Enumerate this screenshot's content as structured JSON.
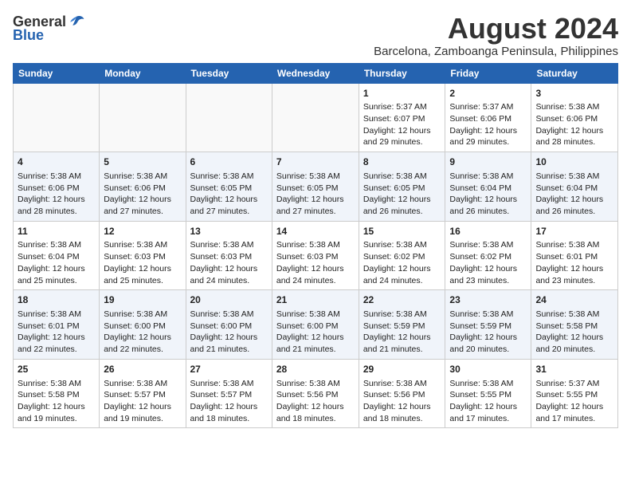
{
  "logo": {
    "general": "General",
    "blue": "Blue"
  },
  "title": "August 2024",
  "subtitle": "Barcelona, Zamboanga Peninsula, Philippines",
  "weekdays": [
    "Sunday",
    "Monday",
    "Tuesday",
    "Wednesday",
    "Thursday",
    "Friday",
    "Saturday"
  ],
  "weeks": [
    [
      {
        "day": "",
        "info": ""
      },
      {
        "day": "",
        "info": ""
      },
      {
        "day": "",
        "info": ""
      },
      {
        "day": "",
        "info": ""
      },
      {
        "day": "1",
        "info": "Sunrise: 5:37 AM\nSunset: 6:07 PM\nDaylight: 12 hours\nand 29 minutes."
      },
      {
        "day": "2",
        "info": "Sunrise: 5:37 AM\nSunset: 6:06 PM\nDaylight: 12 hours\nand 29 minutes."
      },
      {
        "day": "3",
        "info": "Sunrise: 5:38 AM\nSunset: 6:06 PM\nDaylight: 12 hours\nand 28 minutes."
      }
    ],
    [
      {
        "day": "4",
        "info": "Sunrise: 5:38 AM\nSunset: 6:06 PM\nDaylight: 12 hours\nand 28 minutes."
      },
      {
        "day": "5",
        "info": "Sunrise: 5:38 AM\nSunset: 6:06 PM\nDaylight: 12 hours\nand 27 minutes."
      },
      {
        "day": "6",
        "info": "Sunrise: 5:38 AM\nSunset: 6:05 PM\nDaylight: 12 hours\nand 27 minutes."
      },
      {
        "day": "7",
        "info": "Sunrise: 5:38 AM\nSunset: 6:05 PM\nDaylight: 12 hours\nand 27 minutes."
      },
      {
        "day": "8",
        "info": "Sunrise: 5:38 AM\nSunset: 6:05 PM\nDaylight: 12 hours\nand 26 minutes."
      },
      {
        "day": "9",
        "info": "Sunrise: 5:38 AM\nSunset: 6:04 PM\nDaylight: 12 hours\nand 26 minutes."
      },
      {
        "day": "10",
        "info": "Sunrise: 5:38 AM\nSunset: 6:04 PM\nDaylight: 12 hours\nand 26 minutes."
      }
    ],
    [
      {
        "day": "11",
        "info": "Sunrise: 5:38 AM\nSunset: 6:04 PM\nDaylight: 12 hours\nand 25 minutes."
      },
      {
        "day": "12",
        "info": "Sunrise: 5:38 AM\nSunset: 6:03 PM\nDaylight: 12 hours\nand 25 minutes."
      },
      {
        "day": "13",
        "info": "Sunrise: 5:38 AM\nSunset: 6:03 PM\nDaylight: 12 hours\nand 24 minutes."
      },
      {
        "day": "14",
        "info": "Sunrise: 5:38 AM\nSunset: 6:03 PM\nDaylight: 12 hours\nand 24 minutes."
      },
      {
        "day": "15",
        "info": "Sunrise: 5:38 AM\nSunset: 6:02 PM\nDaylight: 12 hours\nand 24 minutes."
      },
      {
        "day": "16",
        "info": "Sunrise: 5:38 AM\nSunset: 6:02 PM\nDaylight: 12 hours\nand 23 minutes."
      },
      {
        "day": "17",
        "info": "Sunrise: 5:38 AM\nSunset: 6:01 PM\nDaylight: 12 hours\nand 23 minutes."
      }
    ],
    [
      {
        "day": "18",
        "info": "Sunrise: 5:38 AM\nSunset: 6:01 PM\nDaylight: 12 hours\nand 22 minutes."
      },
      {
        "day": "19",
        "info": "Sunrise: 5:38 AM\nSunset: 6:00 PM\nDaylight: 12 hours\nand 22 minutes."
      },
      {
        "day": "20",
        "info": "Sunrise: 5:38 AM\nSunset: 6:00 PM\nDaylight: 12 hours\nand 21 minutes."
      },
      {
        "day": "21",
        "info": "Sunrise: 5:38 AM\nSunset: 6:00 PM\nDaylight: 12 hours\nand 21 minutes."
      },
      {
        "day": "22",
        "info": "Sunrise: 5:38 AM\nSunset: 5:59 PM\nDaylight: 12 hours\nand 21 minutes."
      },
      {
        "day": "23",
        "info": "Sunrise: 5:38 AM\nSunset: 5:59 PM\nDaylight: 12 hours\nand 20 minutes."
      },
      {
        "day": "24",
        "info": "Sunrise: 5:38 AM\nSunset: 5:58 PM\nDaylight: 12 hours\nand 20 minutes."
      }
    ],
    [
      {
        "day": "25",
        "info": "Sunrise: 5:38 AM\nSunset: 5:58 PM\nDaylight: 12 hours\nand 19 minutes."
      },
      {
        "day": "26",
        "info": "Sunrise: 5:38 AM\nSunset: 5:57 PM\nDaylight: 12 hours\nand 19 minutes."
      },
      {
        "day": "27",
        "info": "Sunrise: 5:38 AM\nSunset: 5:57 PM\nDaylight: 12 hours\nand 18 minutes."
      },
      {
        "day": "28",
        "info": "Sunrise: 5:38 AM\nSunset: 5:56 PM\nDaylight: 12 hours\nand 18 minutes."
      },
      {
        "day": "29",
        "info": "Sunrise: 5:38 AM\nSunset: 5:56 PM\nDaylight: 12 hours\nand 18 minutes."
      },
      {
        "day": "30",
        "info": "Sunrise: 5:38 AM\nSunset: 5:55 PM\nDaylight: 12 hours\nand 17 minutes."
      },
      {
        "day": "31",
        "info": "Sunrise: 5:37 AM\nSunset: 5:55 PM\nDaylight: 12 hours\nand 17 minutes."
      }
    ]
  ]
}
